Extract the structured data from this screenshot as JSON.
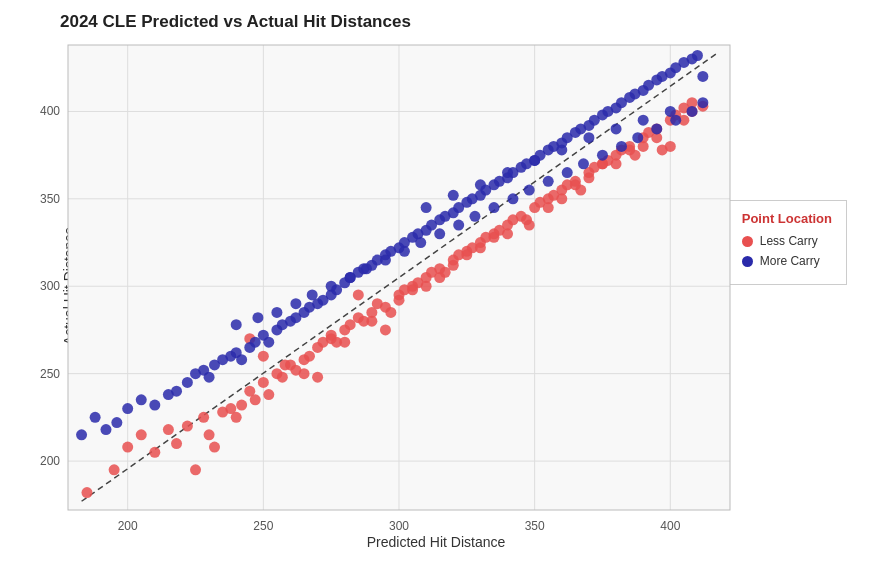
{
  "title": "2024 CLE Predicted vs Actual Hit Distances",
  "xAxisLabel": "Predicted Hit Distance",
  "yAxisLabel": "Actual Hit Distance",
  "legend": {
    "title": "Point Location",
    "items": [
      {
        "label": "Less Carry",
        "color": "#e85050"
      },
      {
        "label": "More Carry",
        "color": "#2a2aaa"
      }
    ]
  },
  "xAxis": {
    "min": 180,
    "max": 420,
    "ticks": [
      200,
      250,
      300,
      350,
      400
    ]
  },
  "yAxis": {
    "min": 175,
    "max": 430,
    "ticks": [
      200,
      250,
      300,
      350,
      400
    ]
  },
  "lessCarryPoints": [
    [
      185,
      182
    ],
    [
      195,
      195
    ],
    [
      200,
      208
    ],
    [
      205,
      215
    ],
    [
      210,
      205
    ],
    [
      215,
      218
    ],
    [
      218,
      210
    ],
    [
      222,
      220
    ],
    [
      225,
      195
    ],
    [
      228,
      225
    ],
    [
      230,
      215
    ],
    [
      232,
      208
    ],
    [
      235,
      228
    ],
    [
      238,
      230
    ],
    [
      240,
      225
    ],
    [
      242,
      232
    ],
    [
      245,
      240
    ],
    [
      247,
      235
    ],
    [
      250,
      245
    ],
    [
      252,
      238
    ],
    [
      255,
      250
    ],
    [
      257,
      248
    ],
    [
      260,
      255
    ],
    [
      262,
      252
    ],
    [
      265,
      258
    ],
    [
      267,
      260
    ],
    [
      270,
      265
    ],
    [
      272,
      268
    ],
    [
      275,
      270
    ],
    [
      277,
      268
    ],
    [
      280,
      275
    ],
    [
      282,
      278
    ],
    [
      285,
      282
    ],
    [
      287,
      280
    ],
    [
      290,
      285
    ],
    [
      292,
      290
    ],
    [
      295,
      288
    ],
    [
      297,
      285
    ],
    [
      300,
      295
    ],
    [
      302,
      298
    ],
    [
      305,
      300
    ],
    [
      307,
      302
    ],
    [
      310,
      305
    ],
    [
      312,
      308
    ],
    [
      315,
      310
    ],
    [
      317,
      308
    ],
    [
      320,
      315
    ],
    [
      322,
      318
    ],
    [
      325,
      320
    ],
    [
      327,
      322
    ],
    [
      330,
      325
    ],
    [
      332,
      328
    ],
    [
      335,
      330
    ],
    [
      337,
      332
    ],
    [
      340,
      335
    ],
    [
      342,
      338
    ],
    [
      345,
      340
    ],
    [
      347,
      338
    ],
    [
      350,
      345
    ],
    [
      352,
      348
    ],
    [
      355,
      350
    ],
    [
      357,
      352
    ],
    [
      360,
      355
    ],
    [
      362,
      358
    ],
    [
      365,
      360
    ],
    [
      367,
      355
    ],
    [
      370,
      365
    ],
    [
      372,
      368
    ],
    [
      375,
      370
    ],
    [
      377,
      372
    ],
    [
      380,
      375
    ],
    [
      382,
      378
    ],
    [
      385,
      380
    ],
    [
      387,
      375
    ],
    [
      390,
      385
    ],
    [
      392,
      388
    ],
    [
      395,
      390
    ],
    [
      397,
      378
    ],
    [
      400,
      395
    ],
    [
      402,
      398
    ],
    [
      405,
      402
    ],
    [
      408,
      405
    ],
    [
      245,
      270
    ],
    [
      250,
      260
    ],
    [
      258,
      255
    ],
    [
      265,
      250
    ],
    [
      270,
      248
    ],
    [
      275,
      272
    ],
    [
      280,
      268
    ],
    [
      285,
      295
    ],
    [
      290,
      280
    ],
    [
      295,
      275
    ],
    [
      300,
      292
    ],
    [
      305,
      298
    ],
    [
      310,
      300
    ],
    [
      315,
      305
    ],
    [
      320,
      312
    ],
    [
      325,
      318
    ],
    [
      330,
      322
    ],
    [
      335,
      328
    ],
    [
      340,
      330
    ],
    [
      348,
      335
    ],
    [
      355,
      345
    ],
    [
      360,
      350
    ],
    [
      365,
      358
    ],
    [
      370,
      362
    ],
    [
      375,
      370
    ],
    [
      380,
      370
    ],
    [
      385,
      378
    ],
    [
      390,
      380
    ],
    [
      395,
      385
    ],
    [
      400,
      380
    ],
    [
      405,
      395
    ],
    [
      408,
      400
    ],
    [
      412,
      403
    ]
  ],
  "moreCarryPoints": [
    [
      183,
      215
    ],
    [
      188,
      225
    ],
    [
      192,
      218
    ],
    [
      196,
      222
    ],
    [
      200,
      230
    ],
    [
      205,
      235
    ],
    [
      210,
      232
    ],
    [
      215,
      238
    ],
    [
      218,
      240
    ],
    [
      222,
      245
    ],
    [
      225,
      250
    ],
    [
      228,
      252
    ],
    [
      230,
      248
    ],
    [
      232,
      255
    ],
    [
      235,
      258
    ],
    [
      238,
      260
    ],
    [
      240,
      262
    ],
    [
      242,
      258
    ],
    [
      245,
      265
    ],
    [
      247,
      268
    ],
    [
      250,
      272
    ],
    [
      252,
      268
    ],
    [
      255,
      275
    ],
    [
      257,
      278
    ],
    [
      260,
      280
    ],
    [
      262,
      282
    ],
    [
      265,
      285
    ],
    [
      267,
      288
    ],
    [
      270,
      290
    ],
    [
      272,
      292
    ],
    [
      275,
      295
    ],
    [
      277,
      298
    ],
    [
      280,
      302
    ],
    [
      282,
      305
    ],
    [
      285,
      308
    ],
    [
      287,
      310
    ],
    [
      290,
      312
    ],
    [
      292,
      315
    ],
    [
      295,
      318
    ],
    [
      297,
      320
    ],
    [
      300,
      322
    ],
    [
      302,
      325
    ],
    [
      305,
      328
    ],
    [
      307,
      330
    ],
    [
      310,
      332
    ],
    [
      312,
      335
    ],
    [
      315,
      338
    ],
    [
      317,
      340
    ],
    [
      320,
      342
    ],
    [
      322,
      345
    ],
    [
      325,
      348
    ],
    [
      327,
      350
    ],
    [
      330,
      352
    ],
    [
      332,
      355
    ],
    [
      335,
      358
    ],
    [
      337,
      360
    ],
    [
      340,
      362
    ],
    [
      342,
      365
    ],
    [
      345,
      368
    ],
    [
      347,
      370
    ],
    [
      350,
      372
    ],
    [
      352,
      375
    ],
    [
      355,
      378
    ],
    [
      357,
      380
    ],
    [
      360,
      382
    ],
    [
      362,
      385
    ],
    [
      365,
      388
    ],
    [
      367,
      390
    ],
    [
      370,
      392
    ],
    [
      372,
      395
    ],
    [
      375,
      398
    ],
    [
      377,
      400
    ],
    [
      380,
      402
    ],
    [
      382,
      405
    ],
    [
      385,
      408
    ],
    [
      387,
      410
    ],
    [
      390,
      412
    ],
    [
      392,
      415
    ],
    [
      395,
      418
    ],
    [
      397,
      420
    ],
    [
      400,
      422
    ],
    [
      402,
      425
    ],
    [
      405,
      428
    ],
    [
      408,
      430
    ],
    [
      410,
      432
    ],
    [
      412,
      420
    ],
    [
      240,
      278
    ],
    [
      248,
      282
    ],
    [
      255,
      285
    ],
    [
      262,
      290
    ],
    [
      268,
      295
    ],
    [
      275,
      300
    ],
    [
      282,
      305
    ],
    [
      288,
      310
    ],
    [
      295,
      315
    ],
    [
      302,
      320
    ],
    [
      308,
      325
    ],
    [
      315,
      330
    ],
    [
      322,
      335
    ],
    [
      328,
      340
    ],
    [
      335,
      345
    ],
    [
      342,
      350
    ],
    [
      348,
      355
    ],
    [
      355,
      360
    ],
    [
      362,
      365
    ],
    [
      368,
      370
    ],
    [
      375,
      375
    ],
    [
      382,
      380
    ],
    [
      388,
      385
    ],
    [
      395,
      390
    ],
    [
      402,
      395
    ],
    [
      408,
      400
    ],
    [
      412,
      405
    ],
    [
      310,
      345
    ],
    [
      320,
      352
    ],
    [
      330,
      358
    ],
    [
      340,
      365
    ],
    [
      350,
      372
    ],
    [
      360,
      378
    ],
    [
      370,
      385
    ],
    [
      380,
      390
    ],
    [
      390,
      395
    ],
    [
      400,
      400
    ]
  ]
}
